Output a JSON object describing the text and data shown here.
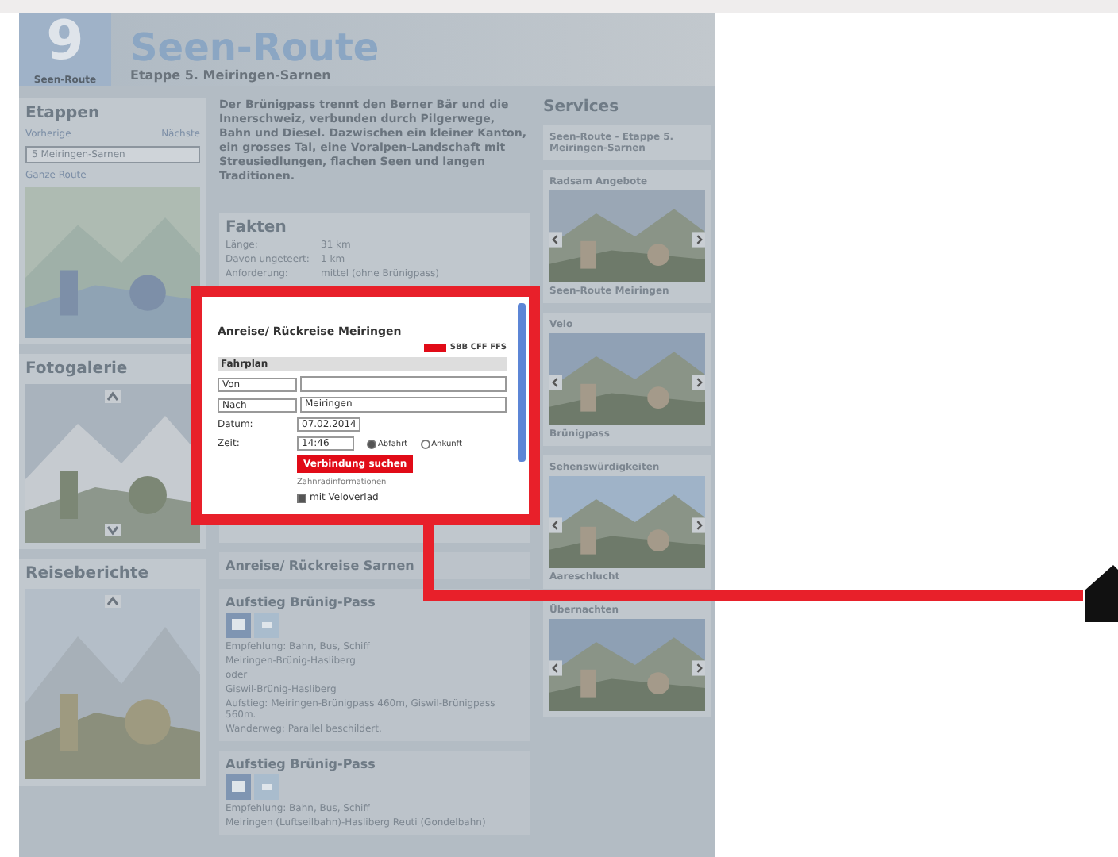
{
  "header": {
    "logo_number": "9",
    "logo_label": "Seen-Route",
    "title": "Seen-Route",
    "subtitle": "Etappe 5. Meiringen-Sarnen"
  },
  "sidebar": {
    "title": "Etappen",
    "prev": "Vorherige",
    "next": "Nächste",
    "stage_select": "5 Meiringen-Sarnen",
    "route_link": "Ganze Route",
    "gallery_title": "Fotogalerie",
    "reports_title": "Reiseberichte"
  },
  "intro": "Der Brünigpass trennt den Berner Bär und die Innerschweiz, verbunden durch Pilgerwege, Bahn und Diesel. Dazwischen ein kleiner Kanton, ein grosses Tal, eine Voralpen-Landschaft mit Streusiedlungen, flachen Seen und langen Traditionen.",
  "facts": {
    "title": "Fakten",
    "rows": [
      {
        "label": "Länge:",
        "value": "31 km"
      },
      {
        "label": "Davon ungeteert:",
        "value": "1 km"
      },
      {
        "label": "Anforderung:",
        "value": "mittel (ohne Brünigpass)"
      }
    ]
  },
  "popup": {
    "title": "Anreise/ Rückreise Meiringen",
    "sbb": "SBB CFF FFS",
    "section": "Fahrplan",
    "from_select": "Von",
    "to_select": "Nach",
    "to_value": "Meiringen",
    "date_label": "Datum:",
    "date": "07.02.2014",
    "time_label": "Zeit:",
    "time": "14:46",
    "modes": [
      {
        "label": "Abfahrt",
        "selected": true
      },
      {
        "label": "Ankunft",
        "selected": false
      }
    ],
    "button": "Verbindung suchen",
    "info_link": "Zahnradinformationen",
    "bike": {
      "label": "mit Veloverlad",
      "checked": true
    }
  },
  "sections": [
    {
      "title": "Anreise/ Rückreise Sarnen"
    },
    {
      "title": "Aufstieg Brünig-Pass",
      "lines": [
        "Empfehlung: Bahn, Bus, Schiff",
        "Meiringen-Brünig-Hasliberg",
        "oder",
        "Giswil-Brünig-Hasliberg",
        "Aufstieg: Meiringen-Brünigpass 460m, Giswil-Brünigpass 560m.",
        "Wanderweg: Parallel beschildert."
      ]
    },
    {
      "title": "Aufstieg Brünig-Pass",
      "lines": [
        "Empfehlung: Bahn, Bus, Schiff",
        "Meiringen (Luftseilbahn)-Hasliberg Reuti (Gondelbahn)"
      ]
    }
  ],
  "services": {
    "title": "Services",
    "cards": [
      {
        "kind": "note",
        "heading": "Seen-Route - Etappe 5. Meiringen-Sarnen"
      },
      {
        "heading": "Radsam Angebote",
        "caption": "Seen-Route Meiringen"
      },
      {
        "heading": "Velo",
        "caption": "Brünigpass"
      },
      {
        "heading": "Sehenswürdigkeiten",
        "caption": "Aareschlucht"
      },
      {
        "heading": "Übernachten"
      }
    ]
  }
}
